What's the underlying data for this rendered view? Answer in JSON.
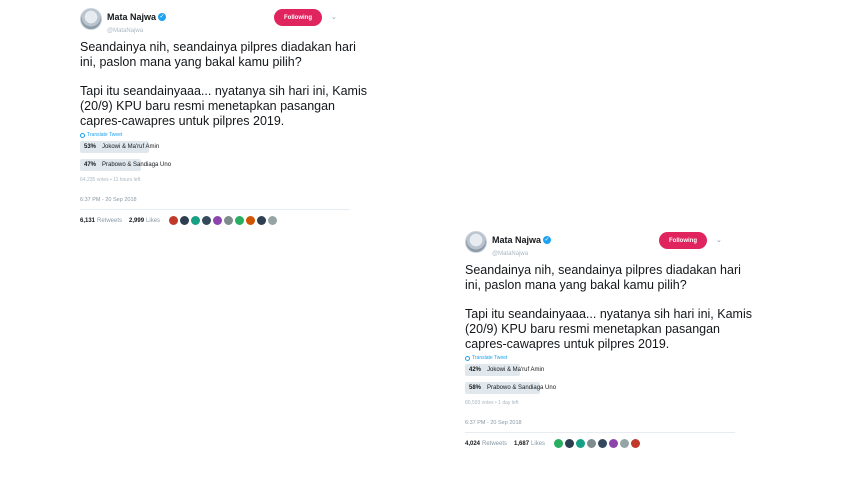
{
  "tweets": [
    {
      "name": "Mata Najwa",
      "handle": "@MataNajwa",
      "follow_label": "Following",
      "text_p1": "Seandainya nih, seandainya pilpres diadakan hari ini, paslon mana yang bakal kamu pilih?",
      "text_p2": "Tapi itu seandainyaaa... nyatanya sih hari ini, Kamis (20/9) KPU baru resmi  menetapkan pasangan capres-cawapres untuk pilpres 2019.",
      "translate": "Translate Tweet",
      "poll": [
        {
          "pct": "53%",
          "value": 0.53,
          "label": "Jokowi & Ma'ruf Amin"
        },
        {
          "pct": "47%",
          "value": 0.47,
          "label": "Prabowo & Sandiaga Uno"
        }
      ],
      "poll_meta": "64,235 votes • 11 hours left",
      "timestamp": "6:37 PM - 20 Sep 2018",
      "retweets": "6,131",
      "retweets_label": "Retweets",
      "likes": "2,999",
      "likes_label": "Likes",
      "avatar_colors": [
        "#c0392b",
        "#2c3e50",
        "#16a085",
        "#34495e",
        "#8e44ad",
        "#7f8c8d",
        "#27ae60",
        "#d35400",
        "#2c3e50",
        "#95a5a6"
      ]
    },
    {
      "name": "Mata Najwa",
      "handle": "@MataNajwa",
      "follow_label": "Following",
      "text_p1": "Seandainya nih, seandainya pilpres diadakan hari ini, paslon mana yang bakal kamu pilih?",
      "text_p2": "Tapi itu seandainyaaa... nyatanya sih hari ini, Kamis (20/9) KPU baru resmi  menetapkan pasangan capres-cawapres untuk pilpres 2019.",
      "translate": "Translate Tweet",
      "poll": [
        {
          "pct": "42%",
          "value": 0.42,
          "label": "Jokowi & Ma'ruf Amin"
        },
        {
          "pct": "58%",
          "value": 0.58,
          "label": "Prabowo & Sandiaga Uno"
        }
      ],
      "poll_meta": "80,593 votes • 1 day left",
      "timestamp": "6:37 PM - 20 Sep 2018",
      "retweets": "4,024",
      "retweets_label": "Retweets",
      "likes": "1,687",
      "likes_label": "Likes",
      "avatar_colors": [
        "#27ae60",
        "#2c3e50",
        "#16a085",
        "#7f8c8d",
        "#34495e",
        "#8e44ad",
        "#95a5a6",
        "#c0392b"
      ]
    }
  ]
}
